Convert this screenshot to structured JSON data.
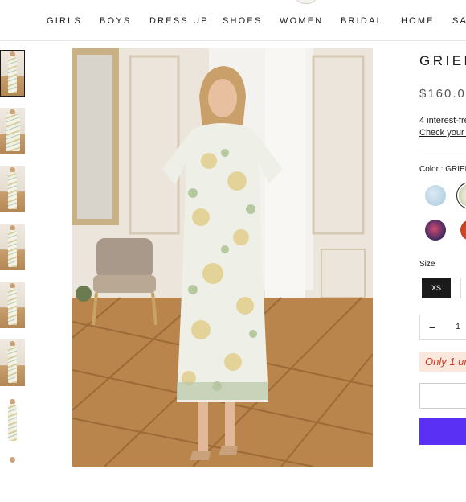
{
  "nav": {
    "items": [
      "GIRLS",
      "BOYS",
      "DRESS UP",
      "SHOES",
      "WOMEN",
      "BRIDAL",
      "HOME",
      "SA"
    ]
  },
  "product": {
    "title": "GRIER",
    "price": "$160.0",
    "installments": "4 interest-fre",
    "check_link": "Check your p",
    "color_label": "Color : GRIER",
    "size_label": "Size",
    "selected_size": "XS",
    "quantity": "1",
    "minus_symbol": "−",
    "stock_message": "Only 1 ur"
  },
  "colors": {
    "buy_button": "#5a31f4",
    "stock_text": "#d23820",
    "stock_bg": "#fbe8dd"
  }
}
